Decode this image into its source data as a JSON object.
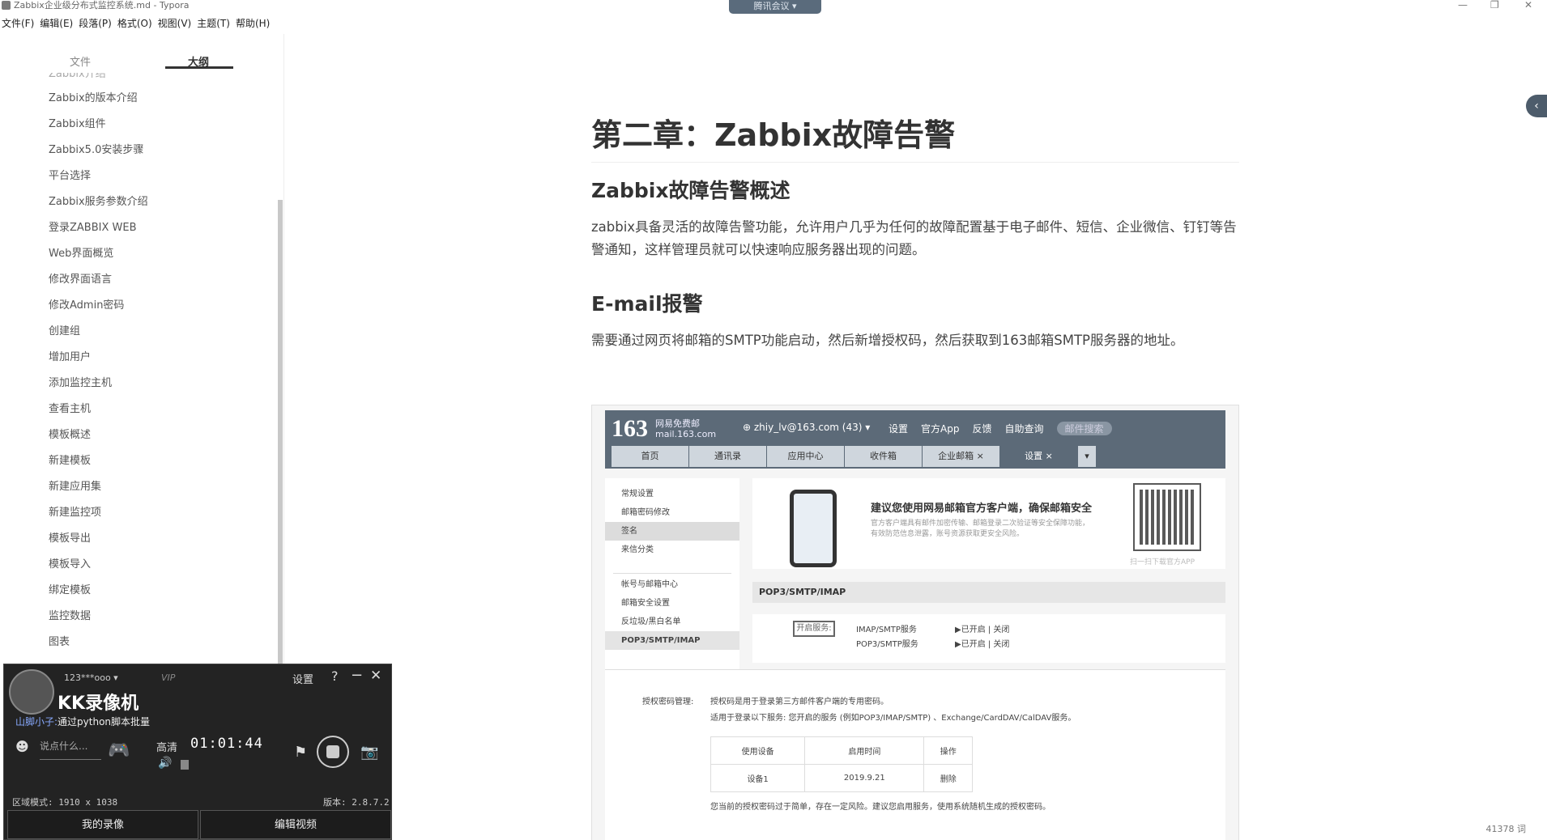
{
  "window": {
    "title": "Zabbix企业级分布式监控系统.md - Typora",
    "meeting_badge": "腾讯会议 ▾",
    "minimize": "—",
    "maximize": "❐",
    "close": "✕"
  },
  "menu": [
    "文件(F)",
    "编辑(E)",
    "段落(P)",
    "格式(O)",
    "视图(V)",
    "主题(T)",
    "帮助(H)"
  ],
  "sidebar": {
    "tabs": {
      "files": "文件",
      "outline": "大纲"
    },
    "clipped_item": "Zabbix介绍",
    "items": [
      "Zabbix的版本介绍",
      "Zabbix组件",
      "Zabbix5.0安装步骤",
      "平台选择",
      "Zabbix服务参数介绍",
      "登录ZABBIX WEB",
      "Web界面概览",
      "修改界面语言",
      "修改Admin密码",
      "创建组",
      "增加用户",
      "添加监控主机",
      "查看主机",
      "模板概述",
      "新建模板",
      "新建应用集",
      "新建监控项",
      "模板导出",
      "模板导入",
      "绑定模板",
      "监控数据",
      "图表"
    ]
  },
  "article": {
    "h1": "第二章：Zabbix故障告警",
    "h2_overview": "Zabbix故障告警概述",
    "p_overview": "zabbix具备灵活的故障告警功能，允许用户几乎为任何的故障配置基于电子邮件、短信、企业微信、钉钉等告警通知，这样管理员就可以快速响应服务器出现的问题。",
    "h2_email": "E-mail报警",
    "p_email": "需要通过网页将邮箱的SMTP功能启动，然后新增授权码，然后获取到163邮箱SMTP服务器的地址。"
  },
  "screenshot": {
    "logo": "163",
    "logo_sub1": "网易免费邮",
    "logo_sub2": "mail.163.com",
    "user": "⊕ zhiy_lv@163.com (43) ▾",
    "toplinks": [
      "设置",
      "官方App",
      "反馈",
      "自助查询"
    ],
    "search": "邮件搜索",
    "navtabs": [
      "首页",
      "通讯录",
      "应用中心",
      "收件箱",
      "企业邮箱 ×",
      "设置 ×"
    ],
    "navmore": "▾",
    "leftmenu_a": [
      "常规设置",
      "邮箱密码修改",
      "签名",
      "来信分类"
    ],
    "leftmenu_b": [
      "帐号与邮箱中心",
      "邮箱安全设置",
      "反垃圾/黑白名单",
      "POP3/SMTP/IMAP"
    ],
    "promo_title": "建议您使用网易邮箱官方客户端，确保邮箱安全",
    "promo_desc": "官方客户端具有邮件加密传输、邮箱登录二次验证等安全保障功能，有效防范信息泄露，账号资源获取更安全风险。",
    "qr_caption": "扫一扫下载官方APP",
    "section_title": "POP3/SMTP/IMAP",
    "open_btn": "开启服务:",
    "svc1": "IMAP/SMTP服务",
    "svc1_status": "▶已开启 | 关闭",
    "svc2": "POP3/SMTP服务",
    "svc2_status": "▶已开启 | 关闭",
    "auth_label": "授权密码管理:",
    "auth_desc1": "授权码是用于登录第三方邮件客户端的专用密码。",
    "auth_desc2": "适用于登录以下服务: 您开启的服务 (例如POP3/IMAP/SMTP) 、Exchange/CardDAV/CalDAV服务。",
    "table_headers": [
      "使用设备",
      "启用时间",
      "操作"
    ],
    "table_row": [
      "设备1",
      "2019.9.21",
      "删除"
    ],
    "auth_note": "您当前的授权密码过于简单，存在一定风险。建议您启用服务，使用系统随机生成的授权密码。"
  },
  "editor": {
    "sidebar_toggle": "‹",
    "word_count": "41378 词"
  },
  "recorder": {
    "account": "123***ooo ▾",
    "vip": "VIP",
    "settings": "设置",
    "help": "?",
    "minimize": "−",
    "close": "✕",
    "brand": "KK录像机",
    "chat_user": "山脚小子:",
    "chat_msg": "通过python脚本批量",
    "emoji": "☻",
    "say_placeholder": "说点什么...",
    "gamepad": "🎮",
    "quality": "高清",
    "timer": "01:01:44",
    "volume": "🔊",
    "flag": "⚑",
    "camera": "📷",
    "region": "区域模式: 1910 x 1038",
    "version": "版本: 2.8.7.2",
    "btn_my": "我的录像",
    "btn_edit": "编辑视频"
  }
}
